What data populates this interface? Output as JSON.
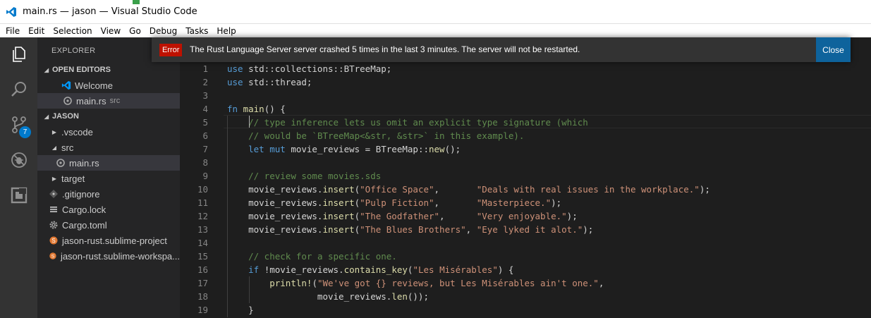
{
  "window": {
    "title": "main.rs — jason — Visual Studio Code"
  },
  "menu": [
    "File",
    "Edit",
    "Selection",
    "View",
    "Go",
    "Debug",
    "Tasks",
    "Help"
  ],
  "activity": {
    "scm_badge": "7"
  },
  "sidebar": {
    "title": "EXPLORER",
    "open_editors": {
      "header": "OPEN EDITORS",
      "items": [
        {
          "label": "Welcome",
          "description": ""
        },
        {
          "label": "main.rs",
          "description": "src"
        }
      ]
    },
    "project": {
      "header": "JASON",
      "items": [
        {
          "label": ".vscode",
          "kind": "folder-collapsed"
        },
        {
          "label": "src",
          "kind": "folder-expanded"
        },
        {
          "label": "main.rs",
          "kind": "rust-file"
        },
        {
          "label": "target",
          "kind": "folder-collapsed"
        },
        {
          "label": ".gitignore",
          "kind": "git-file"
        },
        {
          "label": "Cargo.lock",
          "kind": "lock-file"
        },
        {
          "label": "Cargo.toml",
          "kind": "toml-file"
        },
        {
          "label": "jason-rust.sublime-project",
          "kind": "sublime-file"
        },
        {
          "label": "jason-rust.sublime-workspa...",
          "kind": "sublime-file"
        }
      ]
    }
  },
  "notification": {
    "severity": "Error",
    "message": "The Rust Language Server server crashed 5 times in the last 3 minutes. The server will not be restarted.",
    "close_label": "Close"
  },
  "editor": {
    "line_numbers": [
      "1",
      "2",
      "3",
      "4",
      "5",
      "6",
      "7",
      "8",
      "9",
      "10",
      "11",
      "12",
      "13",
      "14",
      "15",
      "16",
      "17",
      "18",
      "19"
    ],
    "colors": {
      "keyword": "#569cd6",
      "comment": "#608b4e",
      "string": "#ce9178",
      "function": "#dcdcaa",
      "error": "#be1100",
      "accent": "#007acc"
    }
  }
}
